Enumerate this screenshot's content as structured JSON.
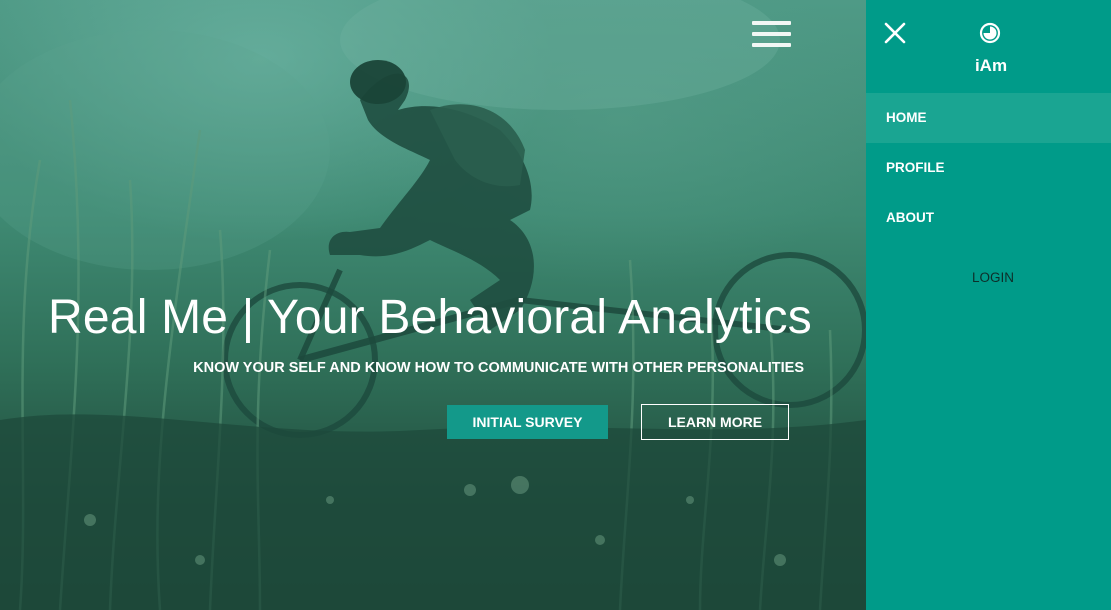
{
  "hero": {
    "title": "Real Me | Your Behavioral Analytics",
    "subtitle": "KNOW YOUR SELF AND KNOW HOW TO COMMUNICATE WITH OTHER PERSONALITIES",
    "primary_button": "INITIAL SURVEY",
    "secondary_button": "LEARN MORE",
    "menu_icon": "hamburger-menu-icon"
  },
  "sidenav": {
    "brand": "iAm",
    "brand_icon": "timer-icon",
    "close_icon": "close-icon",
    "items": [
      {
        "label": "HOME",
        "active": true
      },
      {
        "label": "PROFILE",
        "active": false
      },
      {
        "label": "ABOUT",
        "active": false
      }
    ],
    "login_label": "LOGIN"
  },
  "colors": {
    "sidenav_background": "#009b89",
    "active_item_background": "#1aa592",
    "primary_button": "#13998a",
    "hero_overlay": "#2f7a66",
    "login_text": "#0d2f2a"
  }
}
